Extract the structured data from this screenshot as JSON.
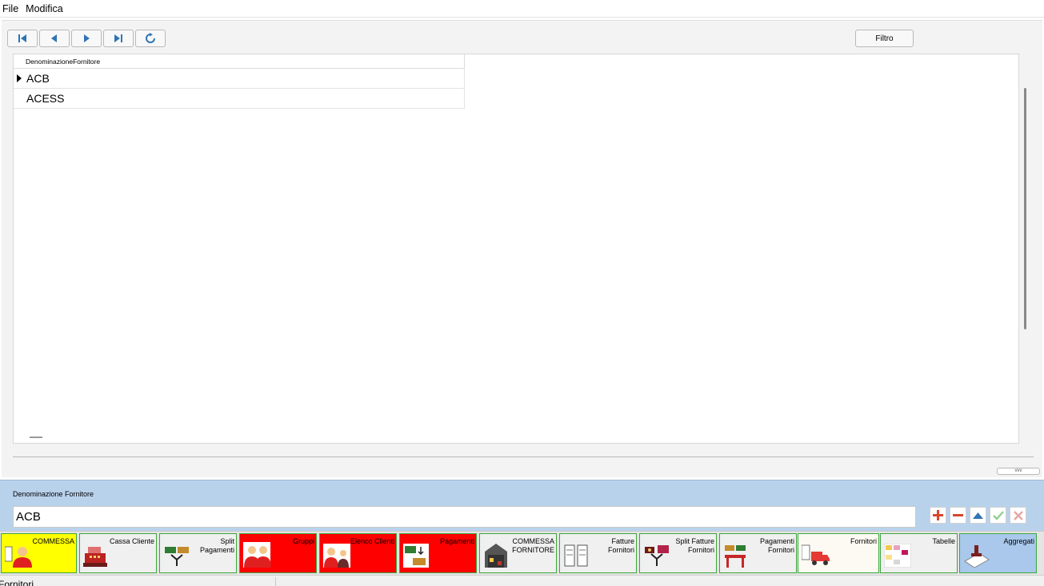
{
  "menu": {
    "items": [
      "File",
      "Modifica"
    ]
  },
  "toolbar": {
    "filter_label": "Filtro"
  },
  "grid": {
    "column_header": "DenominazioneFornitore",
    "rows": [
      "ACB",
      "ACESS"
    ]
  },
  "editor": {
    "field_label": "Denominazione Fornitore",
    "field_value": "ACB"
  },
  "tabs": [
    {
      "label": "COMMESSA",
      "bg": "#ffff00"
    },
    {
      "label": "Cassa Cliente",
      "bg": "#f0f0f0"
    },
    {
      "label": "Split\nPagamenti",
      "bg": "#f0f0f0"
    },
    {
      "label": "Gruppi",
      "bg": "#ff0000"
    },
    {
      "label": "Elenco Clienti",
      "bg": "#ff0000"
    },
    {
      "label": "Pagamenti",
      "bg": "#ff0000"
    },
    {
      "label": "COMMESSA\nFORNITORE",
      "bg": "#f0f0f0"
    },
    {
      "label": "Fatture\nFornitori",
      "bg": "#f0f0f0"
    },
    {
      "label": "Split Fatture\nFornitori",
      "bg": "#f0f0f0"
    },
    {
      "label": "Pagamenti\nFornitori",
      "bg": "#f0f0f0"
    },
    {
      "label": "Fornitori",
      "bg": "#fcfaf3"
    },
    {
      "label": "Tabelle",
      "bg": "#f0f0f0"
    },
    {
      "label": "Aggregati",
      "bg": "#a9c8ec"
    }
  ],
  "status": {
    "text": "Fornitori"
  },
  "colors": {
    "edit_panel_bg": "#b9d2ec",
    "nav_icon": "#2f74b5",
    "add_icon": "#d9462b",
    "remove_icon": "#d9462b",
    "up_icon": "#2f74b5",
    "confirm_icon": "#8fcf8f",
    "cancel_icon": "#e7a6a6"
  }
}
